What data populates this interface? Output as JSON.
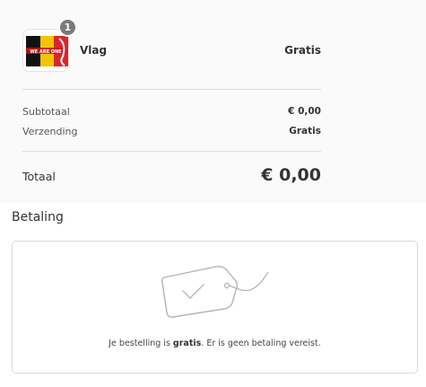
{
  "order_summary": {
    "product": {
      "name": "Vlag",
      "price": "Gratis",
      "quantity": "1",
      "flag_text": "WE ARE ONE"
    },
    "subtotal": {
      "label": "Subtotaal",
      "value": "€ 0,00"
    },
    "shipping": {
      "label": "Verzending",
      "value": "Gratis"
    },
    "total": {
      "label": "Totaal",
      "value": "€ 0,00"
    }
  },
  "payment": {
    "heading": "Betaling",
    "message_prefix": "Je bestelling is ",
    "message_bold": "gratis",
    "message_suffix": ". Er is geen betaling vereist.",
    "icon": "price-tag-check-icon"
  },
  "colors": {
    "summary_bg": "#fafafa",
    "badge_bg": "#7a7a7a",
    "border": "#d9d9d9",
    "flag_black": "#111111",
    "flag_yellow": "#f5c400",
    "flag_red": "#d8262b"
  }
}
